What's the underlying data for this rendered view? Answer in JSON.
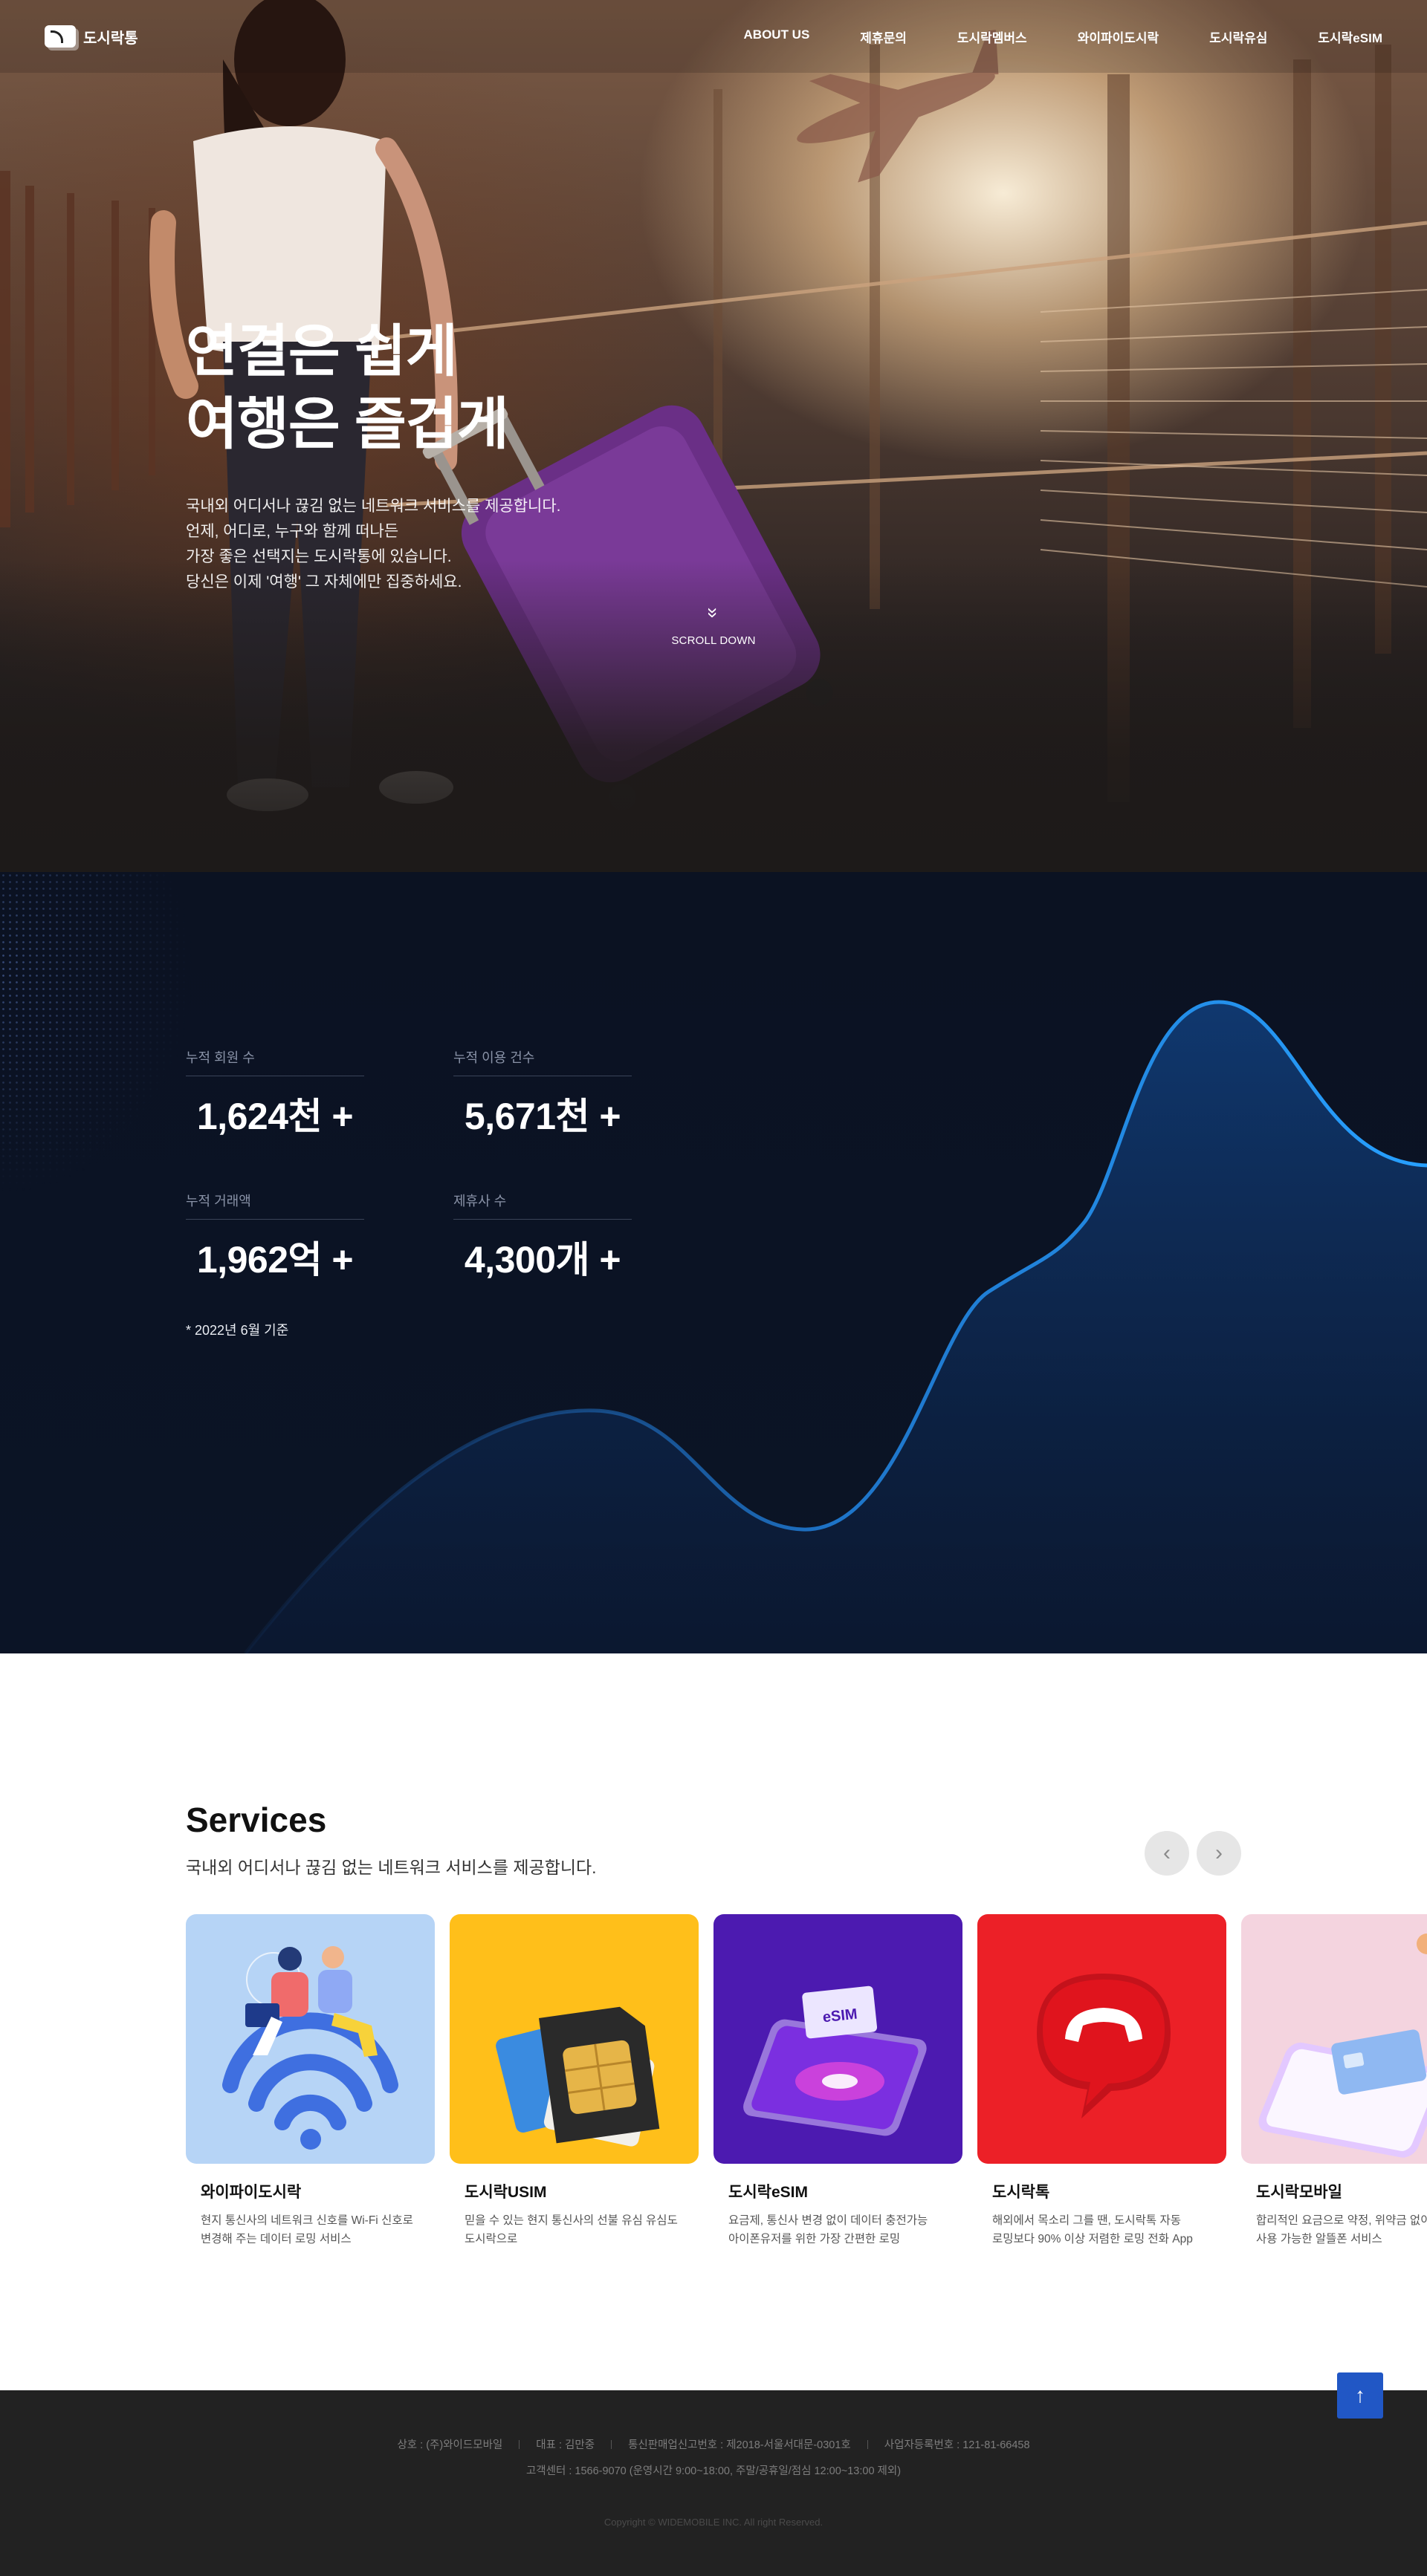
{
  "brand": {
    "name": "도시락통"
  },
  "nav": {
    "items": [
      "ABOUT US",
      "제휴문의",
      "도시락멤버스",
      "와이파이도시락",
      "도시락유심",
      "도시락eSIM"
    ]
  },
  "hero": {
    "headline_1": "연결은 쉽게",
    "headline_2": "여행은 즐겁게",
    "desc": [
      "국내외 어디서나 끊김 없는 네트워크 서비스를 제공합니다.",
      "언제, 어디로, 누구와 함께 떠나든",
      "가장 좋은 선택지는 도시락통에 있습니다.",
      "당신은 이제 '여행' 그 자체에만 집중하세요."
    ],
    "scroll_label": "SCROLL DOWN"
  },
  "stats": {
    "items": [
      {
        "label": "누적 회원 수",
        "value": "1,624천 +"
      },
      {
        "label": "누적 이용 건수",
        "value": "5,671천 +"
      },
      {
        "label": "누적 거래액",
        "value": "1,962억 +"
      },
      {
        "label": "제휴사 수",
        "value": "4,300개 +"
      }
    ],
    "note": "* 2022년 6월 기준"
  },
  "services": {
    "title": "Services",
    "subtitle": "국내외 어디서나 끊김 없는 네트워크 서비스를 제공합니다.",
    "prev_icon": "‹",
    "next_icon": "›",
    "cards": [
      {
        "title": "와이파이도시락",
        "desc": [
          "현지 통신사의 네트워크 신호를 Wi-Fi 신호로",
          "변경해 주는 데이터 로밍 서비스"
        ],
        "color": "#b6d4f6"
      },
      {
        "title": "도시락USIM",
        "desc": [
          "믿을 수 있는 현지 통신사의 선불 유심 유심도",
          "도시락으로"
        ],
        "color": "#ffbf1a"
      },
      {
        "title": "도시락eSIM",
        "desc": [
          "요금제, 통신사 변경 없이 데이터 충전가능",
          "아이폰유저를 위한 가장 간편한 로밍"
        ],
        "color": "#4c1ab0"
      },
      {
        "title": "도시락톡",
        "desc": [
          "해외에서 목소리 그를 땐, 도시락톡 자동",
          "로밍보다 90% 이상 저렴한 로밍 전화 App"
        ],
        "color": "#ec2027"
      },
      {
        "title": "도시락모바일",
        "desc": [
          "합리적인 요금으로 약정, 위약금 없이",
          "사용 가능한 알뜰폰 서비스"
        ],
        "color": "#f4d4df"
      }
    ],
    "esim_chip_text": "eSIM"
  },
  "footer": {
    "company": "상호 : (주)와이드모바일",
    "ceo": "대표 : 김만중",
    "telecom_reg": "통신판매업신고번호 : 제2018-서울서대문-0301호",
    "biz_reg": "사업자등록번호 : 121-81-66458",
    "support": "고객센터 : 1566-9070 (운영시간 9:00~18:00, 주말/공휴일/점심 12:00~13:00 제외)",
    "copyright": "Copyright © WIDEMOBILE INC. All right Reserved.",
    "top_icon": "↑"
  }
}
